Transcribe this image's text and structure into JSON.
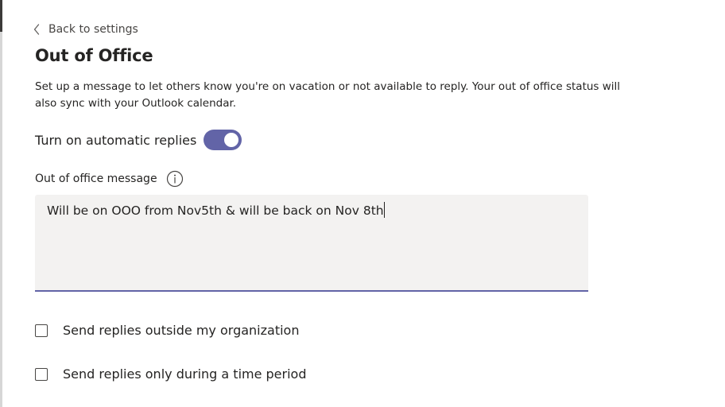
{
  "nav": {
    "back_label": "Back to settings",
    "back_icon": "chevron-left-icon"
  },
  "page": {
    "title": "Out of Office",
    "description": "Set up a message to let others know you're on vacation or not available to reply. Your out of office status will also sync with your Outlook calendar."
  },
  "auto_reply": {
    "label": "Turn on automatic replies",
    "enabled": true,
    "accent_color": "#6264a7"
  },
  "message": {
    "label": "Out of office message",
    "info_icon": "info-icon",
    "value": "Will be on OOO from Nov5th & will be back on Nov 8th"
  },
  "options": [
    {
      "label": "Send replies outside my organization",
      "checked": false
    },
    {
      "label": "Send replies only during a time period",
      "checked": false
    }
  ]
}
